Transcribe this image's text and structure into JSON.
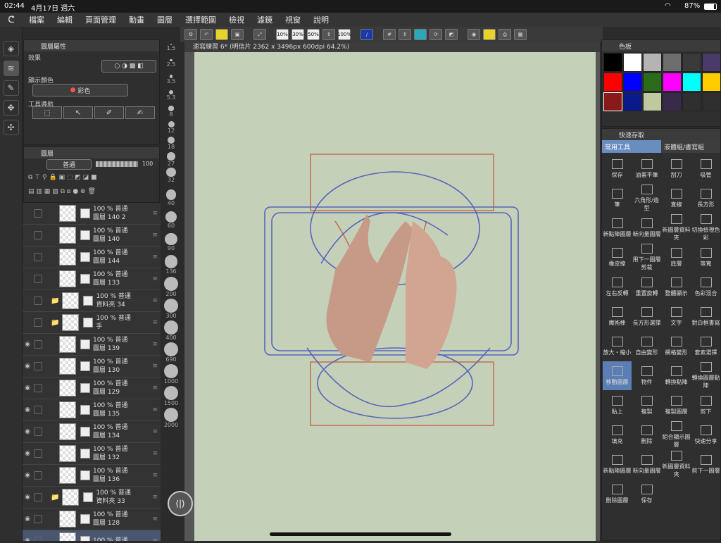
{
  "status": {
    "time": "02:44",
    "date": "4月17日 週六",
    "battery": "87%"
  },
  "menu": [
    "檔案",
    "編輯",
    "頁面管理",
    "動畫",
    "圖層",
    "選擇範圍",
    "檢視",
    "濾鏡",
    "視窗",
    "說明"
  ],
  "toolbar": {
    "zoom": [
      "10%",
      "30%",
      "50%",
      "100%"
    ]
  },
  "layer_property": {
    "title": "圖層屬性",
    "effect_label": "效果",
    "display_color_label": "顯示顏色",
    "display_color_value": "彩色",
    "tool_nav_label": "工具導航"
  },
  "layer_panel": {
    "title": "圖層",
    "blend_mode": "普通",
    "opacity": "100"
  },
  "layers": [
    {
      "pct": "100 %",
      "mode": "普通",
      "name": "圖層 140 2"
    },
    {
      "pct": "100 %",
      "mode": "普通",
      "name": "圖層 140"
    },
    {
      "pct": "100 %",
      "mode": "普通",
      "name": "圖層 144"
    },
    {
      "pct": "100 %",
      "mode": "普通",
      "name": "圖層 133"
    },
    {
      "pct": "100 %",
      "mode": "普通",
      "name": "資料夾 34"
    },
    {
      "pct": "100 %",
      "mode": "普通",
      "name": "手"
    },
    {
      "pct": "100 %",
      "mode": "普通",
      "name": "圖層 139"
    },
    {
      "pct": "100 %",
      "mode": "普通",
      "name": "圖層 130"
    },
    {
      "pct": "100 %",
      "mode": "普通",
      "name": "圖層 129"
    },
    {
      "pct": "100 %",
      "mode": "普通",
      "name": "圖層 135"
    },
    {
      "pct": "100 %",
      "mode": "普通",
      "name": "圖層 134"
    },
    {
      "pct": "100 %",
      "mode": "普通",
      "name": "圖層 132"
    },
    {
      "pct": "100 %",
      "mode": "普通",
      "name": "圖層 136"
    },
    {
      "pct": "100 %",
      "mode": "普通",
      "name": "資料夾 33"
    },
    {
      "pct": "100 %",
      "mode": "普通",
      "name": "圖層 128"
    },
    {
      "pct": "100 %",
      "mode": "普通",
      "name": ""
    }
  ],
  "brush_sizes": [
    "1.5",
    "2.5",
    "3.5",
    "5.3",
    "8",
    "12",
    "18",
    "27",
    "32",
    "40",
    "60",
    "90",
    "136",
    "200",
    "300",
    "400",
    "690",
    "1000",
    "1500",
    "2000"
  ],
  "canvas": {
    "title": "速寫練習 6* (明信片 2362 x 3496px 600dpi 64.2%)"
  },
  "color_panel": {
    "title": "色板",
    "swatches": [
      "#000000",
      "#ffffff",
      "#b4b4b4",
      "#6e6e6e",
      "#3a3a3a",
      "#4a3a6a",
      "#ff0000",
      "#0000ff",
      "#2a6a1a",
      "#ff00ff",
      "#00ffff",
      "#ffcc00",
      "#8a1a1a",
      "#0a1a8a",
      "#c0c8a0",
      "#3a2a4a",
      "#2f2f2f",
      "#2f2f2f"
    ]
  },
  "quick_access": {
    "title": "快速存取",
    "tabs": [
      "常用工具",
      "液體組/書寫組"
    ],
    "items": [
      "保存",
      "油畫平筆",
      "刮刀",
      "吸管",
      "筆",
      "六角形/造型",
      "直線",
      "長方形",
      "新點陣圖層",
      "新向量圖層",
      "新圖層資料夾",
      "切換檢視色彩",
      "橡皮擦",
      "用下一圖層剪裁",
      "底層",
      "等寬",
      "左右反轉",
      "重置旋轉",
      "整體顯示",
      "色彩混合",
      "魔術棒",
      "長方形選擇",
      "文字",
      "對白框書寫",
      "放大・縮小",
      "自由變形",
      "網格變形",
      "套索選擇",
      "移動圖層",
      "物件",
      "轉換點陣",
      "轉換圖層點陣",
      "貼上",
      "複製",
      "複製圖層",
      "剪下",
      "填充",
      "刪除",
      "組合顯示圖層",
      "快速分享",
      "新點陣圖層",
      "新向量圖層",
      "新圖層資料夾",
      "剪下一圖層",
      "刪除圖層",
      "保存"
    ]
  }
}
